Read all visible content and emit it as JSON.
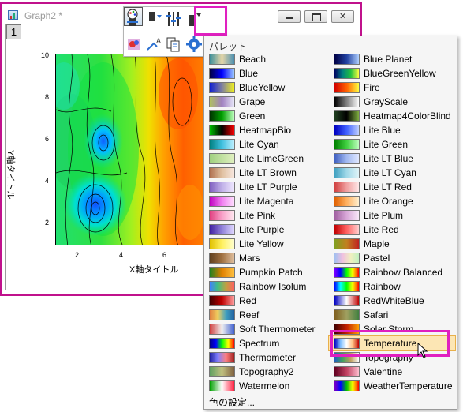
{
  "window": {
    "title": "Graph2 *",
    "layer_label": "1"
  },
  "plot": {
    "y_axis_title": "Y軸タイトル",
    "x_axis_title": "X軸タイトル",
    "y_ticks": [
      "10",
      "8",
      "6",
      "4",
      "2"
    ],
    "x_ticks": [
      "2",
      "4",
      "6"
    ]
  },
  "palette_menu": {
    "header": "パレット",
    "footer": "色の設定...",
    "hovered": "Temperature",
    "items": [
      {
        "label": "Beach",
        "gradient": "linear-gradient(90deg,#3c8f9a,#e6d6a8,#4a8fb0)"
      },
      {
        "label": "Blue Planet",
        "gradient": "linear-gradient(90deg,#000044,#2040a0,#b0d0ff)"
      },
      {
        "label": "Blue",
        "gradient": "linear-gradient(90deg,#000040,#0000ff,#9cc8ff)"
      },
      {
        "label": "BlueGreenYellow",
        "gradient": "linear-gradient(90deg,#000060,#008080,#20c040,#ffff40)"
      },
      {
        "label": "BlueYellow",
        "gradient": "linear-gradient(90deg,#1020d0,#8080a0,#f0f020)"
      },
      {
        "label": "Fire",
        "gradient": "linear-gradient(90deg,#d00000,#ff6000,#ffff40)"
      },
      {
        "label": "Grape",
        "gradient": "linear-gradient(90deg,#b0c060,#a080c0,#e8e8f8)"
      },
      {
        "label": "GrayScale",
        "gradient": "linear-gradient(90deg,#000000,#ffffff)"
      },
      {
        "label": "Green",
        "gradient": "linear-gradient(90deg,#003000,#00a000,#c0ffc0)"
      },
      {
        "label": "Heatmap4ColorBlind",
        "gradient": "linear-gradient(90deg,#204020,#000000,#80b040)"
      },
      {
        "label": "HeatmapBio",
        "gradient": "linear-gradient(90deg,#00c000,#000000,#ff0000)"
      },
      {
        "label": "Lite Blue",
        "gradient": "linear-gradient(90deg,#0000c0,#4060ff,#c0d0ff)"
      },
      {
        "label": "Lite Cyan",
        "gradient": "linear-gradient(90deg,#008080,#40c0e0,#c0f0ff)"
      },
      {
        "label": "Lite Green",
        "gradient": "linear-gradient(90deg,#008000,#40d040,#c0ffc0)"
      },
      {
        "label": "Lite LimeGreen",
        "gradient": "linear-gradient(90deg,#a0d080,#e0f0c0)"
      },
      {
        "label": "Lite LT Blue",
        "gradient": "linear-gradient(90deg,#4060c0,#a0b8f0,#e0e8ff)"
      },
      {
        "label": "Lite LT Brown",
        "gradient": "linear-gradient(90deg,#b07050,#e0c0a0,#f8e8e0)"
      },
      {
        "label": "Lite LT Cyan",
        "gradient": "linear-gradient(90deg,#40a0c0,#a0d8e8,#e0f4f8)"
      },
      {
        "label": "Lite LT Purple",
        "gradient": "linear-gradient(90deg,#8060c0,#c0b0e8,#f0e8ff)"
      },
      {
        "label": "Lite LT Red",
        "gradient": "linear-gradient(90deg,#d04040,#f0a0a0,#ffe8e8)"
      },
      {
        "label": "Lite Magenta",
        "gradient": "linear-gradient(90deg,#c000c0,#f080f0,#ffe0ff)"
      },
      {
        "label": "Lite Orange",
        "gradient": "linear-gradient(90deg,#e06000,#ffb060,#fff0d0)"
      },
      {
        "label": "Lite Pink",
        "gradient": "linear-gradient(90deg,#e04080,#f8a0c8,#ffe8f0)"
      },
      {
        "label": "Lite Plum",
        "gradient": "linear-gradient(90deg,#a060a0,#d8a8d8,#f8e8f8)"
      },
      {
        "label": "Lite Purple",
        "gradient": "linear-gradient(90deg,#4020a0,#9080d8,#e0d8ff)"
      },
      {
        "label": "Lite Red",
        "gradient": "linear-gradient(90deg,#c00000,#ff6060,#ffd0d0)"
      },
      {
        "label": "Lite Yellow",
        "gradient": "linear-gradient(90deg,#e0c000,#fff060,#ffffd0)"
      },
      {
        "label": "Maple",
        "gradient": "linear-gradient(90deg,#80a020,#c08020,#c02020)"
      },
      {
        "label": "Mars",
        "gradient": "linear-gradient(90deg,#604020,#a07040,#e0c0a0)"
      },
      {
        "label": "Pastel",
        "gradient": "linear-gradient(90deg,#a0c0f0,#f0c0e0,#f0f0c0,#c0f0c0)"
      },
      {
        "label": "Pumpkin Patch",
        "gradient": "linear-gradient(90deg,#208020,#e08000,#ffc040)"
      },
      {
        "label": "Rainbow Balanced",
        "gradient": "linear-gradient(90deg,#8000ff,#0000ff,#00ff00,#ffff00,#ff0000)"
      },
      {
        "label": "Rainbow Isolum",
        "gradient": "linear-gradient(90deg,#4080ff,#40c080,#c0a040,#ff6060)"
      },
      {
        "label": "Rainbow",
        "gradient": "linear-gradient(90deg,#0000ff,#00ffff,#00ff00,#ffff00,#ff0000)"
      },
      {
        "label": "Red",
        "gradient": "linear-gradient(90deg,#400000,#c00000,#ffa0a0)"
      },
      {
        "label": "RedWhiteBlue",
        "gradient": "linear-gradient(90deg,#0000c0,#ffffff,#c00000)"
      },
      {
        "label": "Reef",
        "gradient": "linear-gradient(90deg,#e08040,#f0d060,#40a0c0,#2060a0)"
      },
      {
        "label": "Safari",
        "gradient": "linear-gradient(90deg,#806020,#a0a060,#408040)"
      },
      {
        "label": "Soft Thermometer",
        "gradient": "linear-gradient(90deg,#d04040,#f0f0f0,#4060d0)"
      },
      {
        "label": "Solar Storm",
        "gradient": "linear-gradient(90deg,#400000,#c02000,#ffa000)"
      },
      {
        "label": "Spectrum",
        "gradient": "linear-gradient(90deg,#000080,#0000ff,#00ff00,#ffff00,#ff0000)"
      },
      {
        "label": "Temperature",
        "gradient": "linear-gradient(90deg,#0000c0,#80c0ff,#ffffff,#ffc080,#c00000)"
      },
      {
        "label": "Thermometer",
        "gradient": "linear-gradient(90deg,#2020a0,#8080ff,#ff8080,#a02020)"
      },
      {
        "label": "Topography",
        "gradient": "linear-gradient(90deg,#2060c0,#40a060,#c0a060,#ffffff)"
      },
      {
        "label": "Topography2",
        "gradient": "linear-gradient(90deg,#60a060,#c0c080,#806040)"
      },
      {
        "label": "Valentine",
        "gradient": "linear-gradient(90deg,#600020,#c04060,#ffc0d0)"
      },
      {
        "label": "Watermelon",
        "gradient": "linear-gradient(90deg,#00a000,#ffffff,#ff2040)"
      },
      {
        "label": "WeatherTemperature",
        "gradient": "linear-gradient(90deg,#8000c0,#0000ff,#00c000,#ffff00,#ff0000)"
      }
    ]
  },
  "colors": {
    "highlight": "#e020c0",
    "hover_bg": "#fce6b4"
  }
}
